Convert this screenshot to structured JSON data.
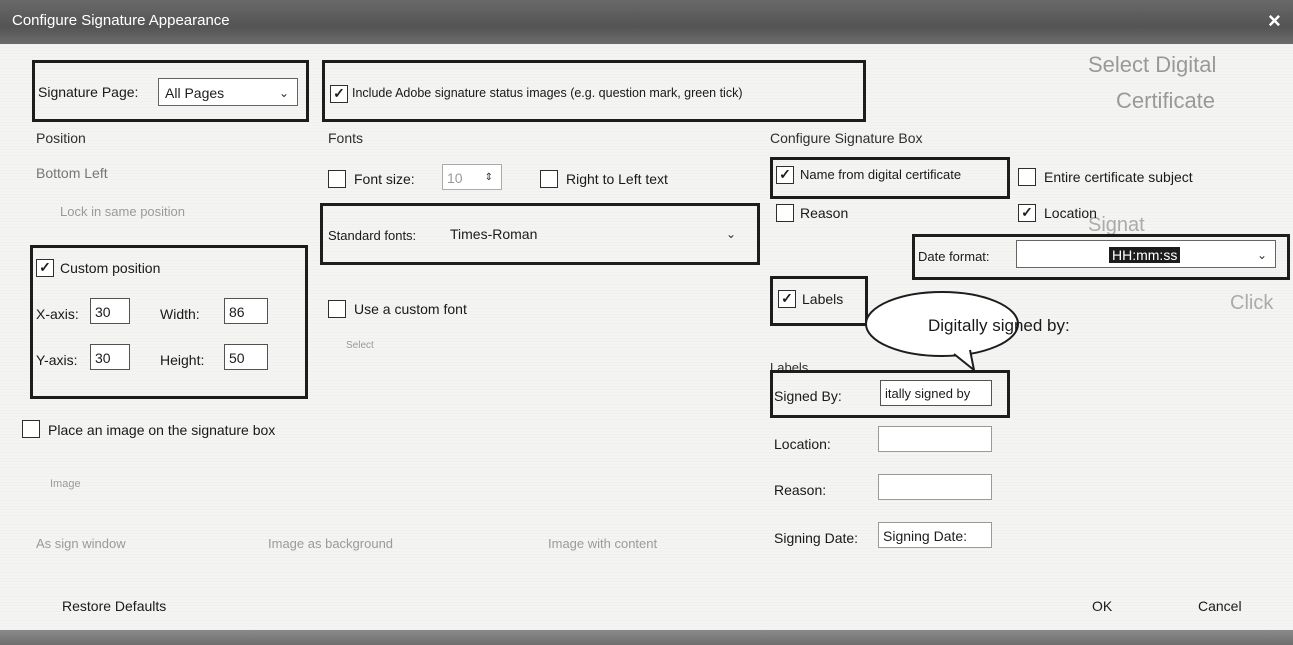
{
  "window": {
    "title": "Configure Signature Appearance",
    "close_symbol": "×"
  },
  "signature_page": {
    "label": "Signature Page:",
    "value": "All Pages"
  },
  "include_status": {
    "checked": true,
    "label": "Include Adobe signature status images (e.g. question mark, green tick)"
  },
  "position": {
    "heading": "Position",
    "value": "Bottom Left",
    "lock_label": "Lock in same position",
    "custom_position": {
      "checked": true,
      "label": "Custom position"
    },
    "x_axis": {
      "label": "X-axis:",
      "value": "30"
    },
    "width": {
      "label": "Width:",
      "value": "86"
    },
    "y_axis": {
      "label": "Y-axis:",
      "value": "30"
    },
    "height": {
      "label": "Height:",
      "value": "50"
    }
  },
  "place_image": {
    "checked": false,
    "label": "Place an image on the signature box"
  },
  "image_options": {
    "label": "Image",
    "opt1": "As sign window",
    "opt2": "Image as background",
    "opt3": "Image with content"
  },
  "fonts": {
    "heading": "Fonts",
    "font_size": {
      "checked": false,
      "label": "Font size:",
      "value": "10"
    },
    "right_to_left": {
      "checked": false,
      "label": "Right to Left text"
    },
    "standard_fonts": {
      "label": "Standard fonts:",
      "value": "Times-Roman"
    },
    "custom_font": {
      "checked": false,
      "label": "Use a custom font"
    },
    "custom_font_hint": "Select"
  },
  "configure_box": {
    "heading": "Configure Signature Box",
    "name_from_cert": {
      "checked": true,
      "label": "Name from digital certificate"
    },
    "entire_subject": {
      "checked": false,
      "label": "Entire certificate subject"
    },
    "reason": {
      "checked": false,
      "label": "Reason"
    },
    "location": {
      "checked": true,
      "label": "Location"
    },
    "date_format": {
      "label": "Date format:",
      "value": "HH:mm:ss"
    },
    "labels_cb": {
      "checked": true,
      "label": "Labels"
    },
    "callout": "Digitally signed by:"
  },
  "labels_section": {
    "heading": "Labels",
    "signed_by": {
      "label": "Signed By:",
      "value": "itally signed by"
    },
    "location": {
      "label": "Location:",
      "value": ""
    },
    "reason": {
      "label": "Reason:",
      "value": ""
    },
    "signing_date": {
      "label": "Signing Date:",
      "value": "Signing Date:"
    }
  },
  "footer": {
    "restore": "Restore Defaults",
    "ok": "OK",
    "cancel": "Cancel"
  },
  "background_text": {
    "line1": "Select Digital",
    "line2": "Certificate",
    "line3": "Signat",
    "line4": "Click"
  },
  "checkmark": "✓",
  "unchecked": "",
  "colors": {
    "titlebar": "#5e5e5e",
    "border": "#222222",
    "background": "#f4f4f2"
  }
}
